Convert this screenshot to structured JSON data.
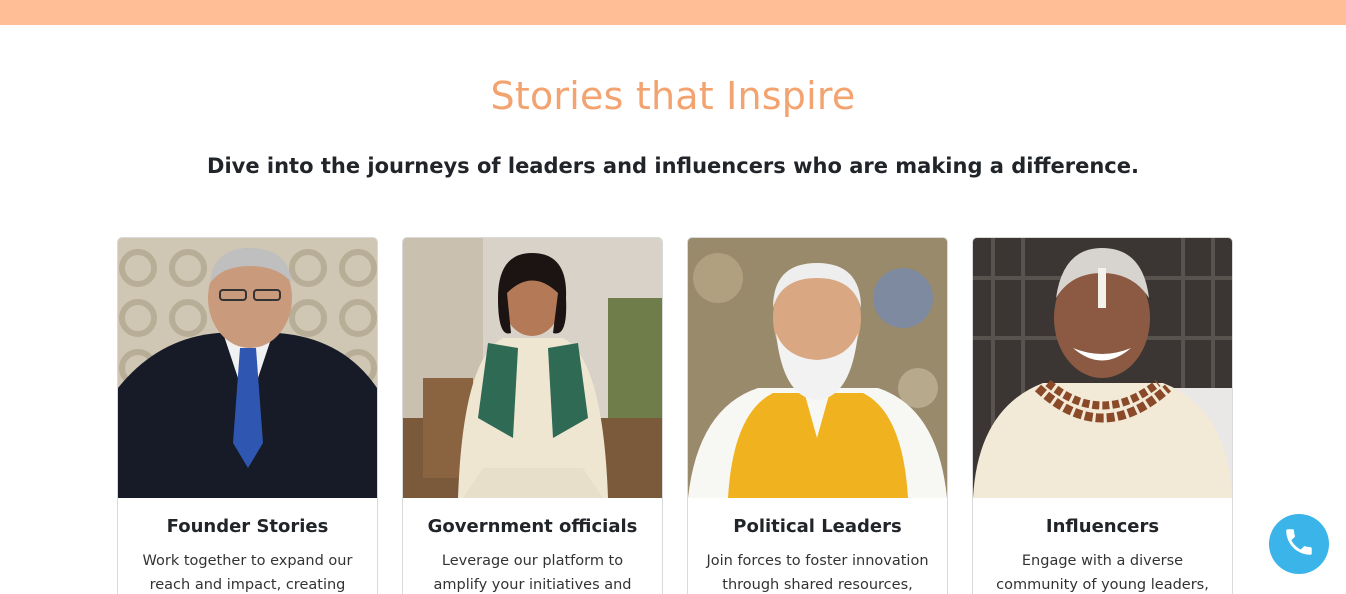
{
  "header": {
    "bar_color": "#ffbe96"
  },
  "section": {
    "title": "Stories that Inspire",
    "subtitle": "Dive into the journeys of leaders and influencers who are making a difference."
  },
  "cards": [
    {
      "title": "Founder Stories",
      "text": "Work together to expand our reach and impact, creating"
    },
    {
      "title": "Government officials",
      "text": "Leverage our platform to amplify your initiatives and"
    },
    {
      "title": "Political Leaders",
      "text": "Join forces to foster innovation through shared resources,"
    },
    {
      "title": "Influencers",
      "text": "Engage with a diverse community of young leaders,"
    }
  ],
  "call_button": {
    "icon": "phone-icon",
    "color": "#3bb4ea"
  },
  "colors": {
    "accent": "#f3a36f",
    "heading": "#212529"
  }
}
